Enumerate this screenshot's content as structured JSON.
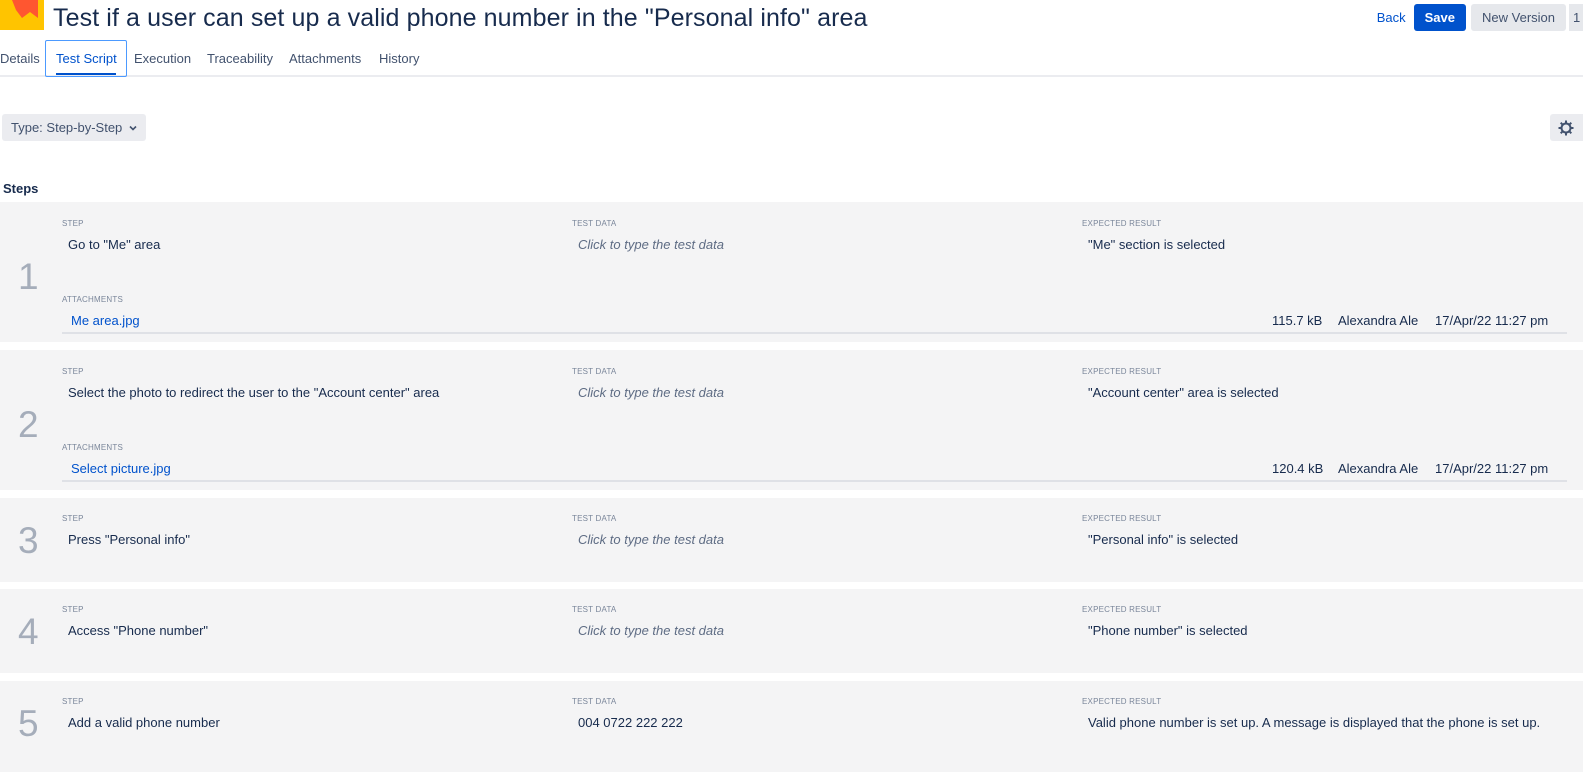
{
  "header": {
    "title": "Test if a user can set up a valid phone number in the \"Personal info\" area",
    "back_label": "Back",
    "save_label": "Save",
    "new_version_label": "New Version",
    "extra_label": "1"
  },
  "tabs": [
    {
      "label": "Details"
    },
    {
      "label": "Test Script"
    },
    {
      "label": "Execution"
    },
    {
      "label": "Traceability"
    },
    {
      "label": "Attachments"
    },
    {
      "label": "History"
    }
  ],
  "active_tab": "Test Script",
  "type_dropdown": {
    "label": "Type: Step-by-Step"
  },
  "steps_heading": "Steps",
  "column_labels": {
    "step": "STEP",
    "test_data": "TEST DATA",
    "expected_result": "EXPECTED RESULT",
    "attachments": "ATTACHMENTS"
  },
  "steps": [
    {
      "number": "1",
      "step": "Go to \"Me\" area",
      "test_data": "Click to type the test data",
      "expected_result": "\"Me\" section is selected",
      "attachment": {
        "name": "Me area.jpg",
        "size": "115.7 kB",
        "user": "Alexandra Ale",
        "date": "17/Apr/22 11:27 pm"
      }
    },
    {
      "number": "2",
      "step": "Select the photo to redirect the user to the \"Account center\" area",
      "test_data": "Click to type the test data",
      "expected_result": "\"Account center\" area is selected",
      "attachment": {
        "name": "Select picture.jpg",
        "size": "120.4 kB",
        "user": "Alexandra Ale",
        "date": "17/Apr/22 11:27 pm"
      }
    },
    {
      "number": "3",
      "step": "Press \"Personal info\"",
      "test_data": "Click to type the test data",
      "expected_result": "\"Personal info\" is selected"
    },
    {
      "number": "4",
      "step": "Access \"Phone number\"",
      "test_data": "Click to type the test data",
      "expected_result": "\"Phone number\" is selected"
    },
    {
      "number": "5",
      "step": "Add a valid phone number",
      "test_data": "004 0722 222 222",
      "expected_result": "Valid phone number is set up. A message is displayed that the phone is set up."
    }
  ],
  "colors": {
    "accent": "#0052cc",
    "step_background": "#f4f4f5",
    "logo_yellow": "#ffc400",
    "logo_red": "#ff5630"
  }
}
